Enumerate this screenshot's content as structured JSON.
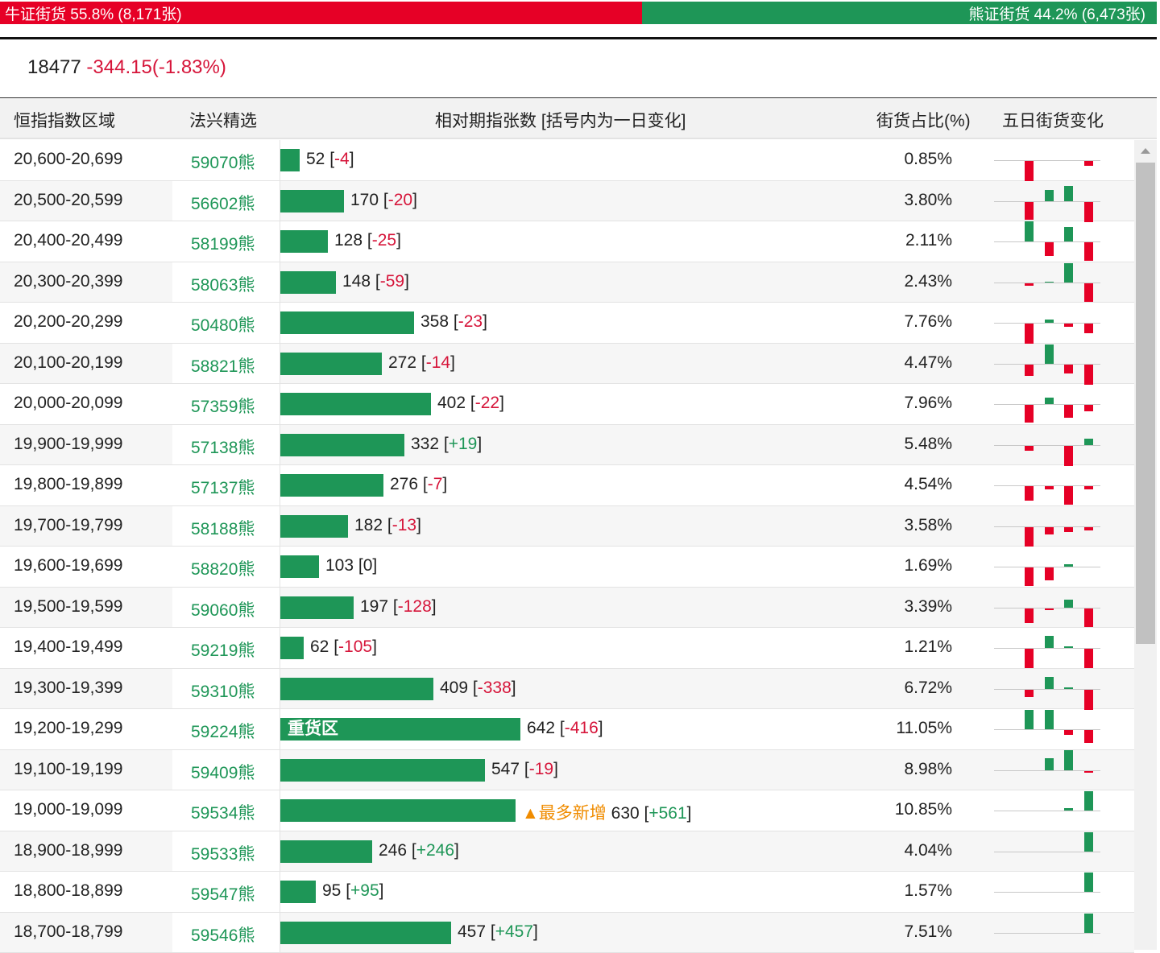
{
  "summary": {
    "bull_label": "牛证街货 55.8% (8,171张)",
    "bear_label": "熊证街货 44.2% (6,473张)",
    "bull_pct": 55.8,
    "bear_pct": 44.2
  },
  "index": {
    "value": "18477",
    "change": "-344.15(-1.83%)"
  },
  "headers": {
    "range": "恒指指数区域",
    "pick": "法兴精选",
    "count": "相对期指张数 [括号内为一日变化]",
    "ratio": "街货占比(%)",
    "trend": "五日街货变化"
  },
  "colors": {
    "red": "#e60026",
    "green": "#1e9657",
    "orange": "#f08c00"
  },
  "rows": [
    {
      "range": "20,600-20,699",
      "code": "59070熊",
      "count": 52,
      "change": "-4",
      "ratio": "0.85%",
      "trend": [
        -25,
        0,
        0,
        -6
      ]
    },
    {
      "range": "20,500-20,599",
      "code": "56602熊",
      "count": 170,
      "change": "-20",
      "ratio": "3.80%",
      "trend": [
        -22,
        14,
        19,
        -25
      ]
    },
    {
      "range": "20,400-20,499",
      "code": "58199熊",
      "count": 128,
      "change": "-25",
      "ratio": "2.11%",
      "trend": [
        25,
        -17,
        18,
        -23
      ]
    },
    {
      "range": "20,300-20,399",
      "code": "58063熊",
      "count": 148,
      "change": "-59",
      "ratio": "2.43%",
      "trend": [
        -3,
        1,
        24,
        -23
      ]
    },
    {
      "range": "20,200-20,299",
      "code": "50480熊",
      "count": 358,
      "change": "-23",
      "ratio": "7.76%",
      "trend": [
        -25,
        4,
        -4,
        -12
      ]
    },
    {
      "range": "20,100-20,199",
      "code": "58821熊",
      "count": 272,
      "change": "-14",
      "ratio": "4.47%",
      "trend": [
        -14,
        24,
        -11,
        -25
      ]
    },
    {
      "range": "20,000-20,099",
      "code": "57359熊",
      "count": 402,
      "change": "-22",
      "ratio": "7.96%",
      "trend": [
        -22,
        8,
        -16,
        -8
      ]
    },
    {
      "range": "19,900-19,999",
      "code": "57138熊",
      "count": 332,
      "change": "+19",
      "ratio": "5.48%",
      "trend": [
        -6,
        0,
        -25,
        8
      ]
    },
    {
      "range": "19,800-19,899",
      "code": "57137熊",
      "count": 276,
      "change": "-7",
      "ratio": "4.54%",
      "trend": [
        -18,
        -4,
        -23,
        -4
      ]
    },
    {
      "range": "19,700-19,799",
      "code": "58188熊",
      "count": 182,
      "change": "-13",
      "ratio": "3.58%",
      "trend": [
        -24,
        -9,
        -6,
        -4
      ]
    },
    {
      "range": "19,600-19,699",
      "code": "58820熊",
      "count": 103,
      "change": "0",
      "ratio": "1.69%",
      "trend": [
        -23,
        -16,
        3,
        0
      ]
    },
    {
      "range": "19,500-19,599",
      "code": "59060熊",
      "count": 197,
      "change": "-128",
      "ratio": "3.39%",
      "trend": [
        -18,
        -2,
        10,
        -23
      ]
    },
    {
      "range": "19,400-19,499",
      "code": "59219熊",
      "count": 62,
      "change": "-105",
      "ratio": "1.21%",
      "trend": [
        -24,
        15,
        2,
        -24
      ]
    },
    {
      "range": "19,300-19,399",
      "code": "59310熊",
      "count": 409,
      "change": "-338",
      "ratio": "6.72%",
      "trend": [
        -9,
        15,
        2,
        -25
      ]
    },
    {
      "range": "19,200-19,299",
      "code": "59224熊",
      "count": 642,
      "change": "-416",
      "ratio": "11.05%",
      "trend": [
        24,
        24,
        -6,
        -16
      ],
      "bar_label": "重货区"
    },
    {
      "range": "19,100-19,199",
      "code": "59409熊",
      "count": 547,
      "change": "-19",
      "ratio": "8.98%",
      "trend": [
        0,
        15,
        25,
        -2
      ]
    },
    {
      "range": "19,000-19,099",
      "code": "59534熊",
      "count": 630,
      "change": "+561",
      "ratio": "10.85%",
      "trend": [
        0,
        0,
        3,
        24
      ],
      "tag": "▲最多新增"
    },
    {
      "range": "18,900-18,999",
      "code": "59533熊",
      "count": 246,
      "change": "+246",
      "ratio": "4.04%",
      "trend": [
        0,
        0,
        0,
        24
      ]
    },
    {
      "range": "18,800-18,899",
      "code": "59547熊",
      "count": 95,
      "change": "+95",
      "ratio": "1.57%",
      "trend": [
        0,
        0,
        0,
        24
      ]
    },
    {
      "range": "18,700-18,799",
      "code": "59546熊",
      "count": 457,
      "change": "+457",
      "ratio": "7.51%",
      "trend": [
        0,
        0,
        0,
        24
      ]
    }
  ]
}
